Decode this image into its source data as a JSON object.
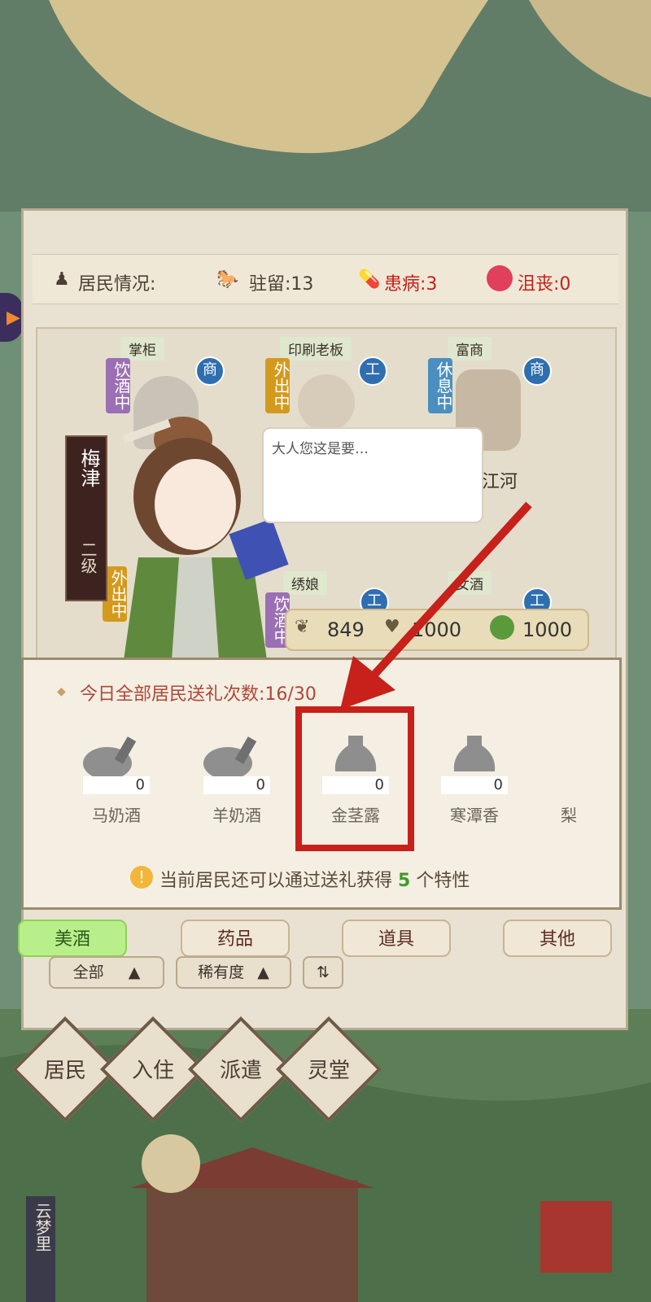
{
  "status": {
    "label": "居民情况:",
    "stay_label": "驻留:13",
    "sick_label": "患病:3",
    "sad_label": "沮丧:0"
  },
  "residents": [
    {
      "title": "掌柜",
      "state": "饮酒中",
      "badge": "商",
      "state_color": "#9b6fb3"
    },
    {
      "title": "印刷老板",
      "state": "外出中",
      "badge": "工",
      "state_color": "#d39a1e"
    },
    {
      "title": "富商",
      "state": "休息中",
      "badge": "商",
      "state_color": "#4a8fc0"
    },
    {
      "title": "绣娘",
      "state": "饮酒中",
      "badge": "工",
      "state_color": "#9b6fb3"
    },
    {
      "title": "女酒",
      "state": "",
      "badge": "工",
      "state_color": "#4a8fc0"
    }
  ],
  "left_state": "外出中",
  "hidden_name": "江河",
  "nameplate": {
    "name": "梅津",
    "level": "二级"
  },
  "speech": "大人您这是要…",
  "stats": {
    "v1": "849",
    "v2": "1000",
    "v3": "1000"
  },
  "gift": {
    "count_label": "今日全部居民送礼次数:16/30",
    "items": [
      {
        "name": "马奶酒",
        "count": "0"
      },
      {
        "name": "羊奶酒",
        "count": "0"
      },
      {
        "name": "金茎露",
        "count": "0"
      },
      {
        "name": "寒潭香",
        "count": "0"
      },
      {
        "name": "梨",
        "count": ""
      }
    ],
    "hint_prefix": "当前居民还可以通过送礼获得",
    "hint_num": "5",
    "hint_suffix": "个特性"
  },
  "tabs": [
    "美酒",
    "药品",
    "道具",
    "其他"
  ],
  "filters": {
    "all": "全部",
    "rarity": "稀有度"
  },
  "nav": [
    "居民",
    "入住",
    "派遣",
    "灵堂"
  ],
  "bottom_left": "云梦里",
  "colors": {
    "accent_red": "#c8201a",
    "active_tab": "#b9ef8b",
    "hint_green": "#3f9a2c"
  }
}
